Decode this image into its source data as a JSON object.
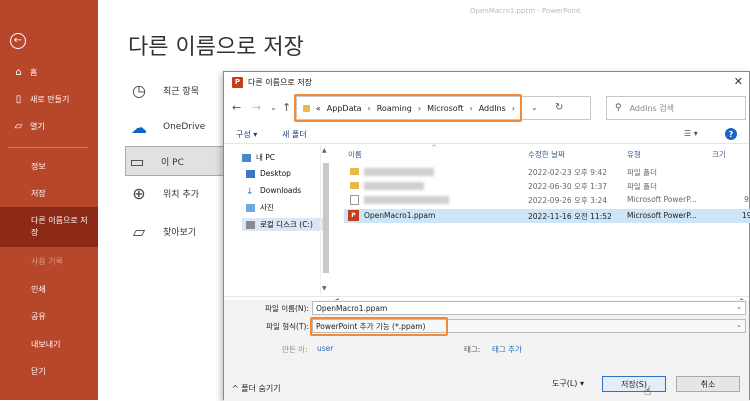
{
  "window": {
    "title": "OpenMacro1.pptm  -  PowerPoint"
  },
  "sidebar": {
    "items": [
      {
        "label": "홈",
        "icon": "home-icon"
      },
      {
        "label": "새로 만들기",
        "icon": "new-file-icon"
      },
      {
        "label": "열기",
        "icon": "open-folder-icon"
      },
      {
        "label": "정보"
      },
      {
        "label": "저장"
      },
      {
        "label": "다른 이름으로 저장"
      },
      {
        "label": "사용 기록"
      },
      {
        "label": "인쇄"
      },
      {
        "label": "공유"
      },
      {
        "label": "내보내기"
      },
      {
        "label": "닫기"
      }
    ]
  },
  "backstage": {
    "title": "다른 이름으로 저장",
    "locations": [
      {
        "label": "최근 항목",
        "icon": "clock-icon"
      },
      {
        "label": "OneDrive",
        "icon": "cloud-icon"
      },
      {
        "label": "이 PC",
        "icon": "pc-icon"
      },
      {
        "label": "위치 추가",
        "icon": "globe-plus-icon"
      },
      {
        "label": "찾아보기",
        "icon": "folder-browse-icon"
      }
    ]
  },
  "dialog": {
    "title": "다른 이름으로 저장",
    "address": {
      "prefix": "«",
      "segments": [
        "AppData",
        "Roaming",
        "Microsoft",
        "AddIns"
      ]
    },
    "search_placeholder": "AddIns 검색",
    "toolbar": {
      "organize": "구성 ▾",
      "new_folder": "새 폴더"
    },
    "tree": [
      {
        "label": "내 PC"
      },
      {
        "label": "Desktop"
      },
      {
        "label": "Downloads"
      },
      {
        "label": "사진"
      },
      {
        "label": "로컬 디스크 (C:)"
      }
    ],
    "columns": [
      "이름",
      "수정한 날짜",
      "유형",
      "크기"
    ],
    "files": [
      {
        "name": "",
        "date": "2022-02-23 오후 9:42",
        "type": "파일 폴더",
        "size": ""
      },
      {
        "name": "",
        "date": "2022-06-30 오후 1:37",
        "type": "파일 폴더",
        "size": ""
      },
      {
        "name": "",
        "date": "2022-09-26 오후 3:24",
        "type": "Microsoft PowerP...",
        "size": "9"
      },
      {
        "name": "OpenMacro1.ppam",
        "date": "2022-11-16 오전 11:52",
        "type": "Microsoft PowerP...",
        "size": "19"
      }
    ],
    "fields": {
      "filename_label": "파일 이름(N):",
      "filename_value": "OpenMacro1.ppam",
      "filetype_label": "파일 형식(T):",
      "filetype_value": "PowerPoint 추가 기능 (*.ppam)",
      "author_label": "만든 이:",
      "author_value": "user",
      "tags_label": "태그:",
      "tags_value": "태그 추가"
    },
    "bottom": {
      "hide_folders": "^ 폴더 숨기기",
      "tools": "도구(L)  ▾",
      "save": "저장(S)",
      "cancel": "취소"
    }
  },
  "colors": {
    "sidebar": "#b7472a",
    "sidebar_active": "#8c2a17",
    "highlight": "#f28a3a",
    "selection": "#cde5f7"
  }
}
